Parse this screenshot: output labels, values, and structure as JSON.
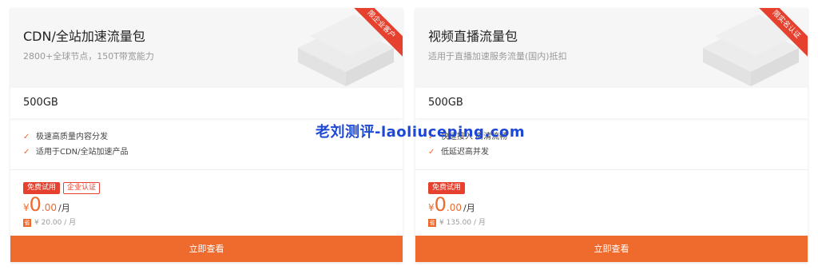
{
  "cards": [
    {
      "title": "CDN/全站加速流量包",
      "desc": "2800+全球节点，150T带宽能力",
      "ribbon": "限企业客户",
      "selected": "500GB",
      "features": [
        "极速高质量内容分发",
        "适用于CDN/全站加速产品"
      ],
      "tags": [
        "免费试用",
        "企业认证"
      ],
      "price": {
        "currency": "¥",
        "int": "0",
        "dec": ".00",
        "unit": "/月"
      },
      "orig_badge": "省",
      "orig": "¥ 20.00 / 月",
      "button": "立即查看"
    },
    {
      "title": "视频直播流量包",
      "desc": "适用于直播加速服务流量(国内)抵扣",
      "ribbon": "限实名认证",
      "selected": "500GB",
      "features": [
        "快速接入 高清流畅",
        "低延迟高并发"
      ],
      "tags": [
        "免费试用"
      ],
      "price": {
        "currency": "¥",
        "int": "0",
        "dec": ".00",
        "unit": "/月"
      },
      "orig_badge": "省",
      "orig": "¥ 135.00 / 月",
      "button": "立即查看"
    }
  ],
  "watermark": "老刘测评-laoliuceping.com"
}
